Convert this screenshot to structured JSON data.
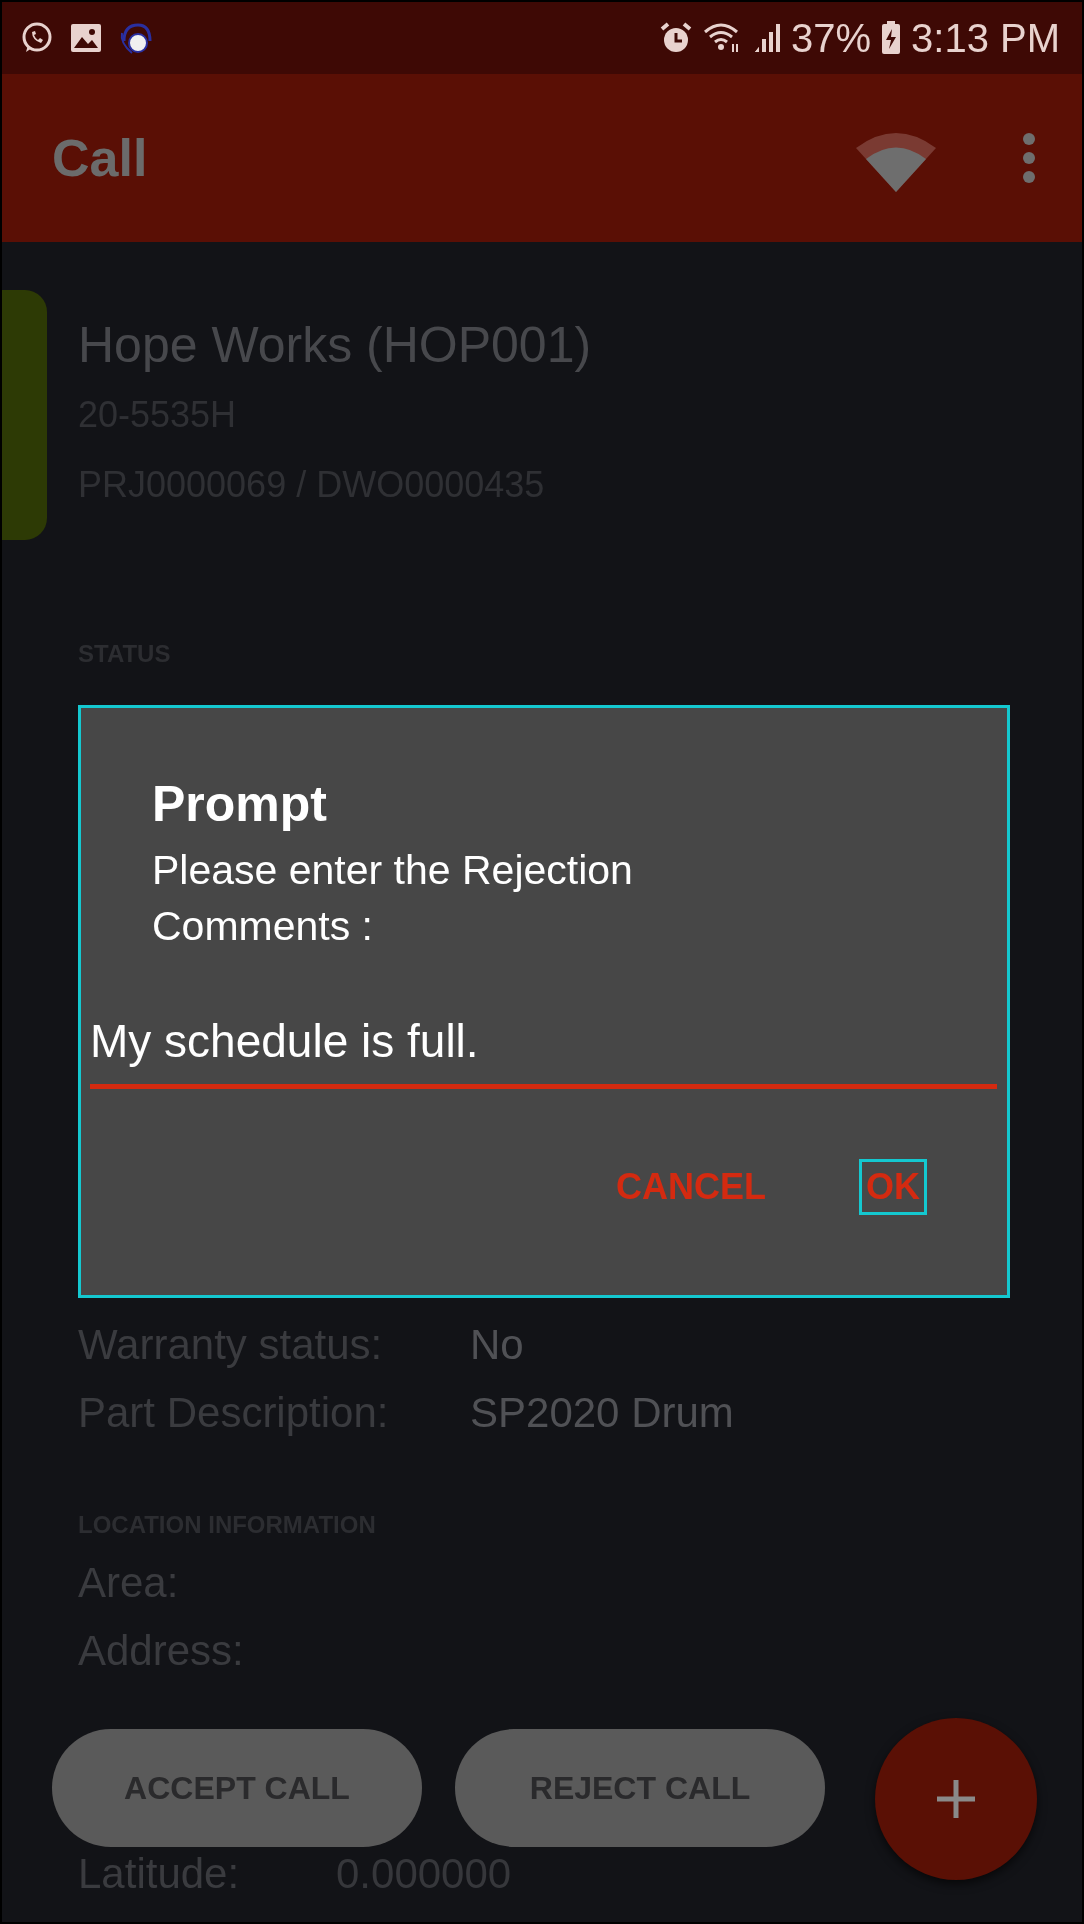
{
  "status_bar": {
    "battery": "37%",
    "time": "3:13 PM"
  },
  "app_bar": {
    "title": "Call"
  },
  "call": {
    "customer": "Hope Works (HOP001)",
    "serial": "20-5535H",
    "reference": "PRJ0000069 / DWO0000435"
  },
  "status": {
    "heading": "STATUS"
  },
  "details": [
    {
      "label": "Warranty status:",
      "value": "No"
    },
    {
      "label": "Part Description:",
      "value": "SP2020 Drum"
    }
  ],
  "location": {
    "heading": "LOCATION INFORMATION",
    "rows": [
      {
        "label": "Area:"
      },
      {
        "label": "Address:"
      },
      {
        "label": "Latitude:",
        "value": "0.000000"
      }
    ]
  },
  "actions": [
    {
      "label": "ACCEPT CALL"
    },
    {
      "label": "REJECT CALL"
    }
  ],
  "dialog": {
    "title": "Prompt",
    "message": "Please enter the Rejection Comments :",
    "input_value": "My schedule is full.",
    "buttons": [
      {
        "label": "CANCEL",
        "focused": false
      },
      {
        "label": "OK",
        "focused": true
      }
    ]
  }
}
